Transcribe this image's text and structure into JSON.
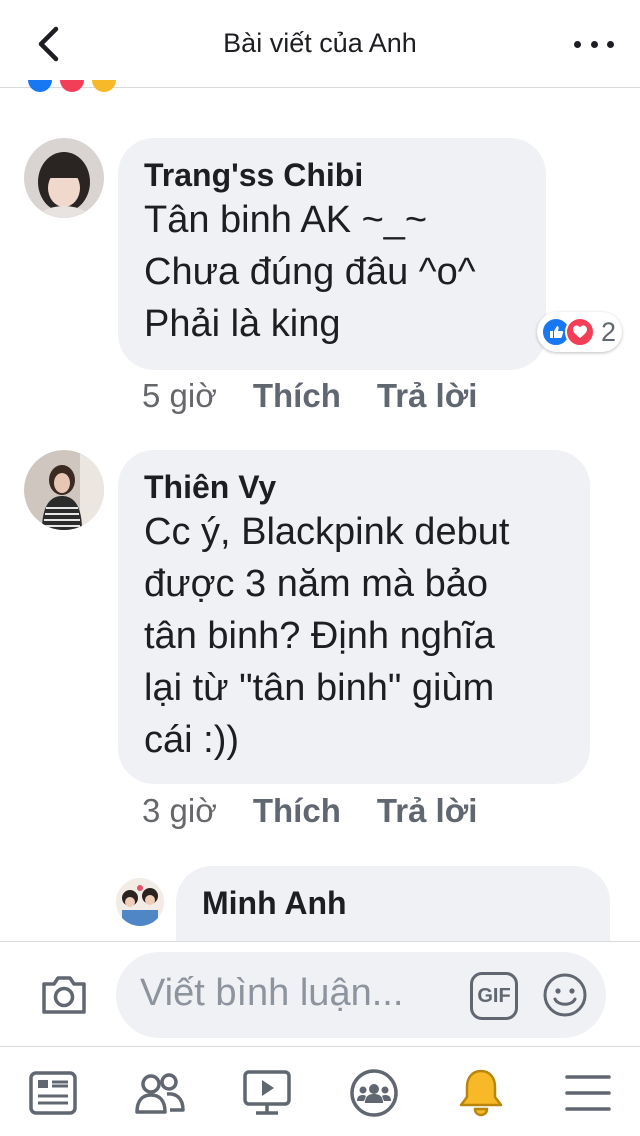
{
  "header": {
    "title": "Bài viết của Anh",
    "back_icon": "chevron-left-icon",
    "more_icon": "more-horizontal-icon"
  },
  "comments": [
    {
      "author": "Trang'ss Chibi",
      "lines": [
        "Tân binh AK ~_~",
        "Chưa đúng đâu ^o^",
        "Phải là king"
      ],
      "time": "5 giờ",
      "like_label": "Thích",
      "reply_label": "Trả lời",
      "reactions": {
        "icons": [
          "like-icon",
          "love-icon"
        ],
        "count": "2"
      }
    },
    {
      "author": "Thiên Vy",
      "lines": [
        "Cc ý, Blackpink debut",
        "được 3 năm mà bảo",
        "tân binh? Định nghĩa",
        "lại từ \"tân binh\" giùm",
        "cái :))"
      ],
      "time": "3 giờ",
      "like_label": "Thích",
      "reply_label": "Trả lời"
    },
    {
      "author": "Minh Anh"
    }
  ],
  "composer": {
    "placeholder": "Viết bình luận...",
    "gif_label": "GIF"
  },
  "tabbar": {
    "items": [
      "news-feed-icon",
      "friends-icon",
      "watch-icon",
      "groups-icon",
      "notifications-icon",
      "menu-icon"
    ],
    "active": "notifications-icon"
  },
  "colors": {
    "like_blue": "#1877f2",
    "love_red": "#f33e58",
    "bell_gold": "#f7b928",
    "bubble_bg": "#f0f1f4",
    "meta_gray": "#65676b"
  }
}
